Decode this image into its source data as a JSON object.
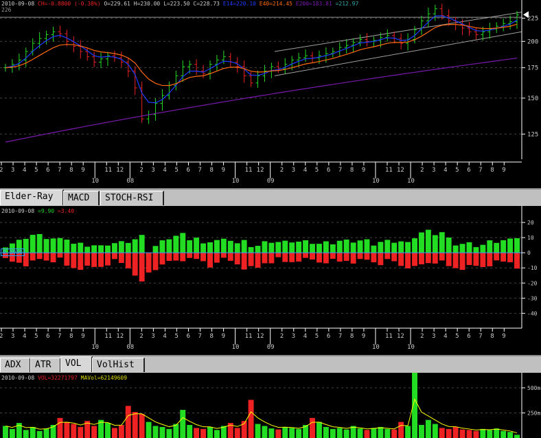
{
  "main_legend": {
    "date": "2010-09-08",
    "ch": "CH=-0.8800 (-0.38%)",
    "o": "O=229.61",
    "h": "H=230.00",
    "l": "L=223.50",
    "c": "C=228.73",
    "e14": "E14=220.10",
    "e40": "E40=214.45",
    "e200": "E200=183.81",
    "extra": "=212.97",
    "cursor_price": "226"
  },
  "colors": {
    "up": "#22dd22",
    "down": "#ee2222",
    "e14": "#1e3cff",
    "e40": "#ff6a10",
    "e200": "#7a1ab0",
    "channel": "#a0a0a0",
    "vol_ma": "#ffff00",
    "axis": "#ffffff"
  },
  "elder_tabs": [
    "Elder-Ray",
    "MACD",
    "STOCH-RSI"
  ],
  "elder_active": 0,
  "elder_legend": {
    "date": "2010-09-08",
    "bull": "=9.90",
    "bear": "=3.40",
    "zero_label": "0.0000"
  },
  "vol_tabs": [
    "ADX",
    "ATR",
    "VOL",
    "VolHist"
  ],
  "vol_active": 2,
  "vol_legend": {
    "date": "2010-09-08",
    "vol": "VOL=32271797",
    "mavol": "MAVol=62149609"
  },
  "chart_data": {
    "type": "ohlc",
    "price_axis": {
      "ticks": [
        225,
        200,
        175,
        150,
        125
      ],
      "range": [
        110,
        245
      ],
      "scale": "log"
    },
    "elder_axis": {
      "ticks": [
        20,
        10,
        0,
        -10,
        -20,
        -30,
        -40
      ],
      "range": [
        -48,
        30
      ]
    },
    "vol_axis": {
      "ticks": [
        {
          "v": 500,
          "label": "500m"
        },
        {
          "v": 250,
          "label": "250m"
        }
      ],
      "range": [
        0,
        650
      ]
    },
    "x_labels": [
      "2",
      "3",
      "4",
      "5",
      "6",
      "7",
      "8",
      "9",
      "10",
      "11",
      "12",
      "08",
      "2",
      "3",
      "4",
      "5",
      "6",
      "7",
      "8",
      "9",
      "10",
      "11",
      "12",
      "09",
      "2",
      "3",
      "4",
      "5",
      "6",
      "7",
      "8",
      "9",
      "10",
      "11",
      "12",
      "10",
      "2",
      "3",
      "4",
      "5",
      "6",
      "7",
      "8",
      "9"
    ],
    "year_labels": [
      "08",
      "09",
      "10"
    ],
    "closes": [
      175,
      178,
      182,
      190,
      198,
      203,
      207,
      210,
      208,
      200,
      195,
      190,
      185,
      180,
      183,
      186,
      184,
      180,
      172,
      158,
      135,
      138,
      146,
      152,
      160,
      168,
      176,
      178,
      172,
      170,
      178,
      182,
      185,
      180,
      176,
      168,
      162,
      168,
      172,
      176,
      174,
      178,
      182,
      184,
      186,
      184,
      186,
      188,
      190,
      194,
      196,
      199,
      202,
      200,
      201,
      204,
      206,
      203,
      198,
      202,
      212,
      222,
      230,
      236,
      228,
      222,
      218,
      214,
      210,
      207,
      210,
      213,
      216,
      219,
      221,
      228.73
    ],
    "volumes_m": [
      120,
      90,
      150,
      80,
      110,
      70,
      95,
      130,
      200,
      160,
      140,
      110,
      170,
      120,
      180,
      150,
      100,
      130,
      320,
      260,
      240,
      160,
      120,
      110,
      90,
      140,
      280,
      130,
      100,
      90,
      110,
      80,
      120,
      150,
      100,
      170,
      380,
      140,
      120,
      95,
      85,
      110,
      100,
      90,
      130,
      200,
      160,
      110,
      90,
      100,
      85,
      120,
      95,
      80,
      100,
      110,
      90,
      85,
      160,
      120,
      650,
      130,
      180,
      140,
      100,
      90,
      110,
      85,
      80,
      70,
      90,
      80,
      95,
      70,
      60,
      32
    ]
  }
}
